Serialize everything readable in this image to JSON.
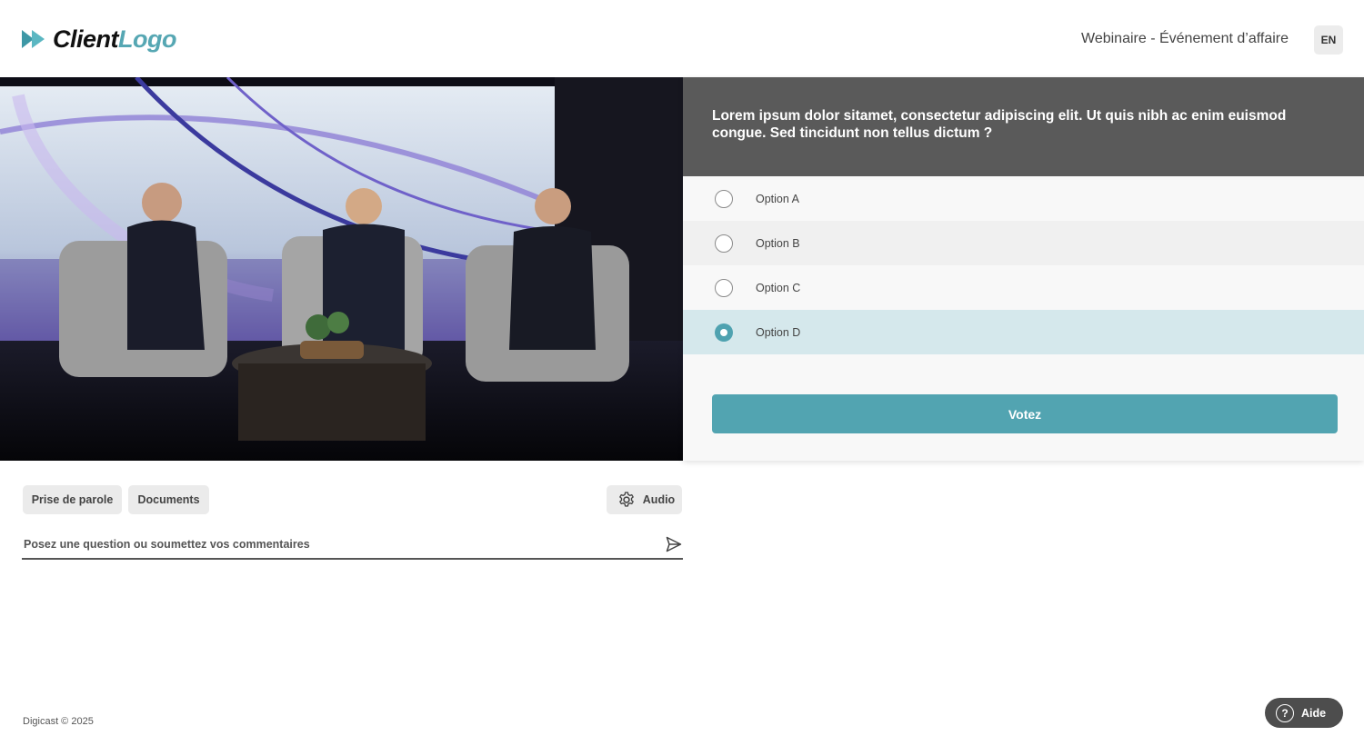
{
  "header": {
    "logo_part1": "Client",
    "logo_part2": "Logo",
    "event_title": "Webinaire - Événement d’affaire",
    "language": "EN"
  },
  "poll": {
    "question": "Lorem ipsum dolor sitamet, consectetur adipiscing elit. Ut quis nibh ac enim euismod congue. Sed tincidunt non tellus dictum ?",
    "options": [
      {
        "label": "Option A",
        "selected": false
      },
      {
        "label": "Option B",
        "selected": false
      },
      {
        "label": "Option C",
        "selected": false
      },
      {
        "label": "Option D",
        "selected": true
      }
    ],
    "vote_label": "Votez"
  },
  "controls": {
    "speak_label": "Prise de parole",
    "documents_label": "Documents",
    "audio_label": "Audio",
    "comment_placeholder": "Posez une question ou soumettez vos commentaires"
  },
  "footer": {
    "copyright": "Digicast © 2025",
    "help_label": "Aide"
  },
  "colors": {
    "accent": "#52a4b1",
    "selected_row": "#d5e8ec",
    "question_bg": "#5a5a5a"
  }
}
